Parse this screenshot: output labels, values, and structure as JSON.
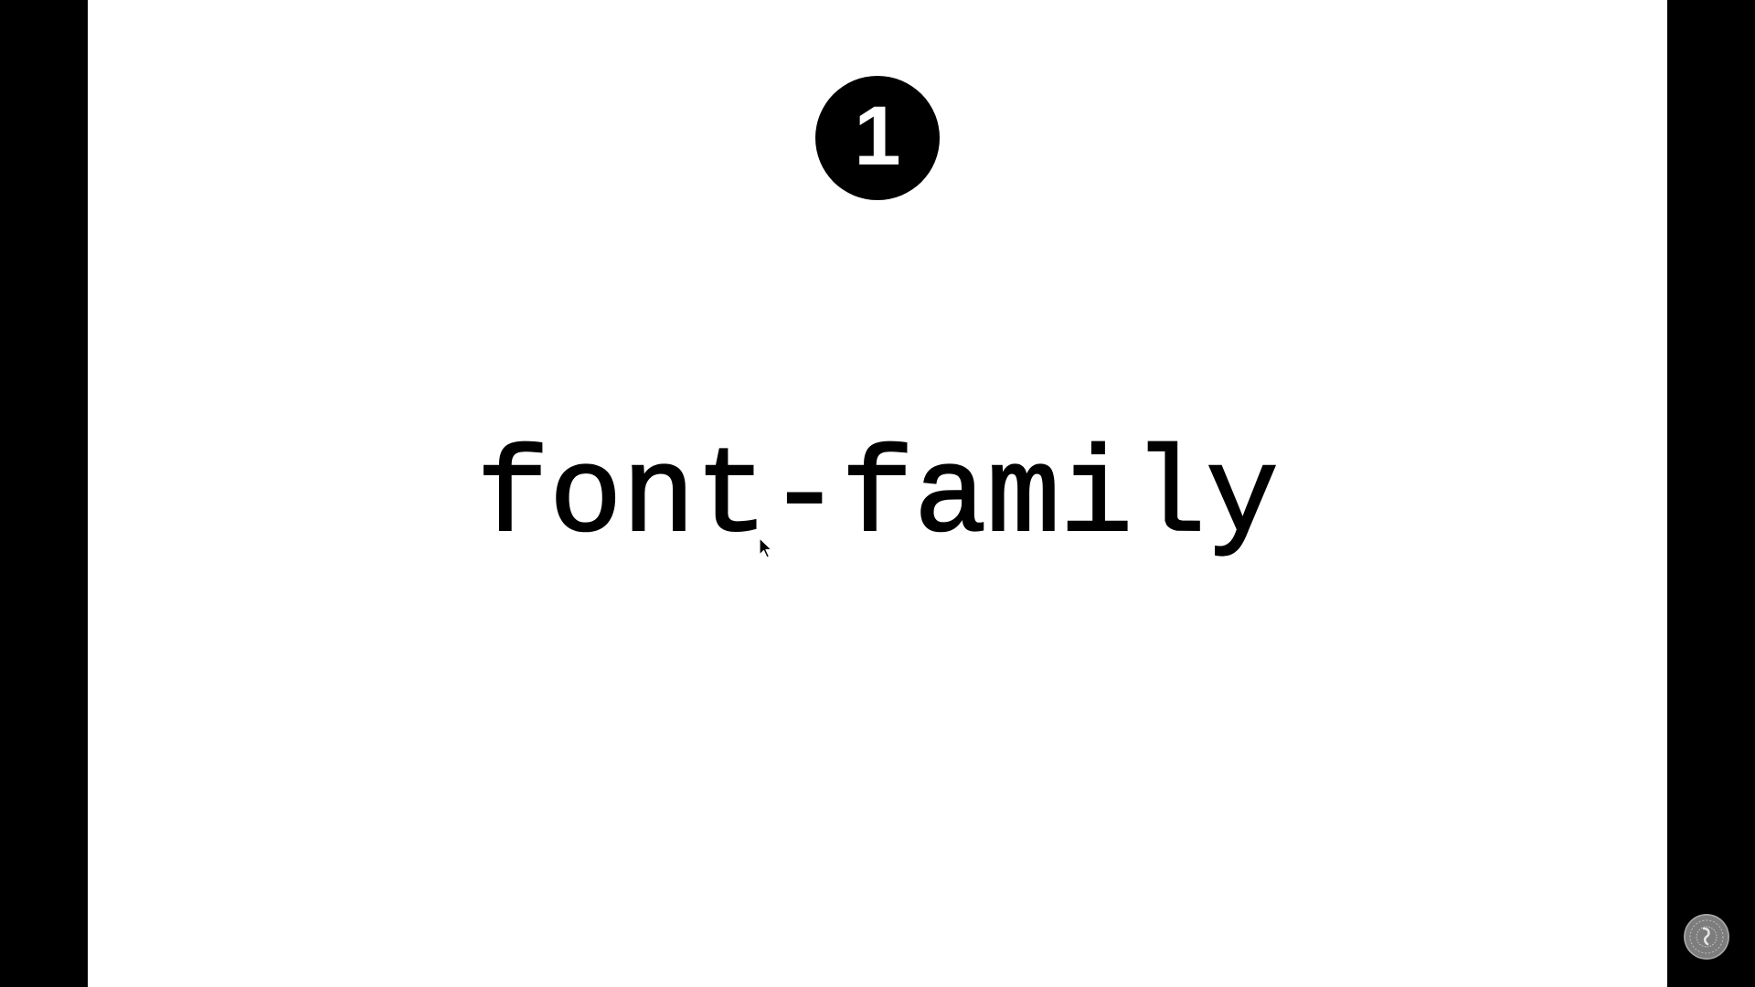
{
  "slide": {
    "step_number": "1",
    "keyword": "font-family"
  },
  "colors": {
    "letterbox": "#000000",
    "slide_background": "#ffffff",
    "badge_background": "#000000",
    "badge_text": "#ffffff",
    "keyword_text": "#000000"
  },
  "icons": {
    "cursor": "mouse-pointer-icon",
    "watermark": "channel-logo-icon"
  }
}
